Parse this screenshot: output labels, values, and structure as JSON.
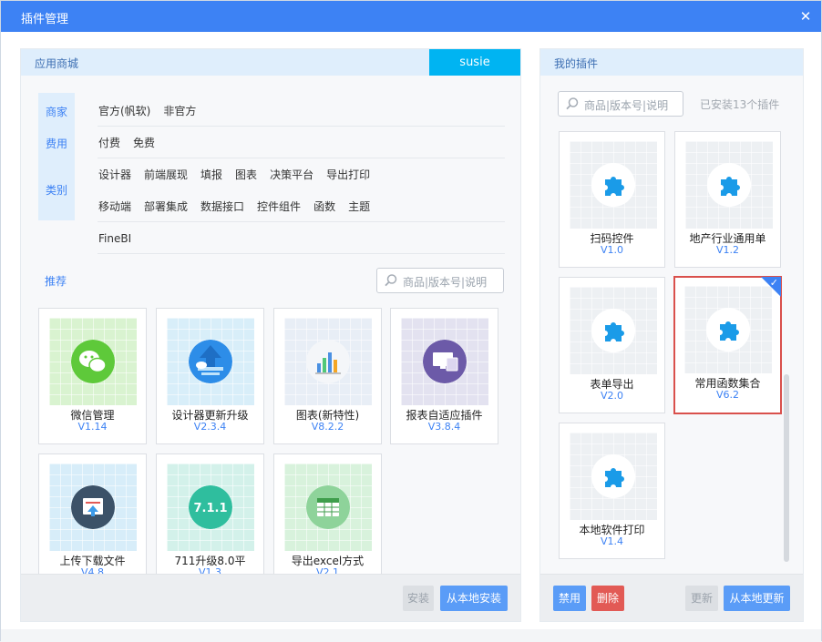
{
  "window": {
    "title": "插件管理",
    "close_glyph": "✕"
  },
  "store": {
    "title": "应用商城",
    "user": "susie",
    "tabs": [
      "商家",
      "费用",
      "类别"
    ],
    "filters": {
      "vendor": [
        "官方(帆软)",
        "非官方"
      ],
      "cost": [
        "付费",
        "免费"
      ],
      "category_row1": [
        "设计器",
        "前端展现",
        "填报",
        "图表",
        "决策平台",
        "导出打印"
      ],
      "category_row2": [
        "移动端",
        "部署集成",
        "数据接口",
        "控件组件",
        "函数",
        "主题"
      ],
      "category_row3": [
        "FineBI"
      ]
    },
    "recommend_label": "推荐",
    "search_placeholder": "商品|版本号|说明",
    "plugins": [
      {
        "name": "微信管理",
        "version": "V1.14",
        "icon": "wechat-icon",
        "color": "#5ec93a"
      },
      {
        "name": "设计器更新升级",
        "version": "V2.3.4",
        "icon": "upgrade-arrow-icon",
        "color": "#2d8de8"
      },
      {
        "name": "图表(新特性)",
        "version": "V8.2.2",
        "icon": "bar-chart-icon",
        "color": "#f1f4f8"
      },
      {
        "name": "报表自适应插件",
        "version": "V3.8.4",
        "icon": "responsive-screens-icon",
        "color": "#6c5aa8"
      },
      {
        "name": "上传下载文件",
        "version": "V4.8",
        "icon": "upload-file-icon",
        "color": "#3c5268"
      },
      {
        "name": "711升级8.0平",
        "version": "V1.3",
        "icon": "version-badge-icon",
        "color": "#2fbe9e",
        "badge": "7.1.1"
      },
      {
        "name": "导出excel方式",
        "version": "V2.1",
        "icon": "excel-export-icon",
        "color": "#4caf50"
      }
    ],
    "install_label": "安装",
    "install_local_label": "从本地安装"
  },
  "mine": {
    "title": "我的插件",
    "search_placeholder": "商品|版本号|说明",
    "installed_count_text": "已安装13个插件",
    "plugins": [
      {
        "name": "扫码控件",
        "version": "V1.0",
        "icon": "puzzle-icon"
      },
      {
        "name": "地产行业通用单",
        "version": "V1.2",
        "icon": "puzzle-icon"
      },
      {
        "name": "表单导出",
        "version": "V2.0",
        "icon": "puzzle-icon"
      },
      {
        "name": "常用函数集合",
        "version": "V6.2",
        "icon": "puzzle-icon",
        "selected": true
      },
      {
        "name": "本地软件打印",
        "version": "V1.4",
        "icon": "puzzle-icon"
      }
    ],
    "disable_label": "禁用",
    "delete_label": "删除",
    "update_label": "更新",
    "update_local_label": "从本地更新"
  },
  "colors": {
    "accent": "#3d82f4",
    "user_tab": "#00b4f2",
    "danger": "#e25a55",
    "puzzle": "#1a9be8"
  }
}
